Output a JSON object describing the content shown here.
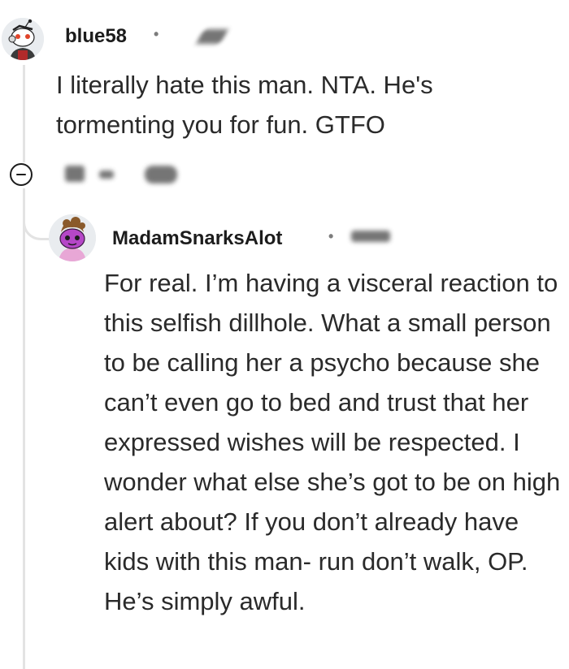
{
  "comments": [
    {
      "username": "blue58",
      "separator": "•",
      "text": "I literally hate this man. NTA. He's tormenting you for fun. GTFO",
      "avatar_icon": "snoo-avatar-icon"
    },
    {
      "username": "MadamSnarksAlot",
      "separator": "•",
      "text": "For real. I’m having a visceral reaction to this selfish dillhole. What a small person to be calling her a psycho because she can’t even go to bed and trust that her expressed wishes will be respected. I wonder what else she’s got to be on high alert about? If you don’t already have kids with this man- run don’t walk, OP. He’s simply awful.",
      "avatar_icon": "snoo-avatar-icon"
    }
  ],
  "controls": {
    "collapse_icon": "collapse-icon"
  },
  "colors": {
    "text": "#2a2a2a",
    "username": "#1c1c1c",
    "meta": "#7c7c7c",
    "thread_line": "#e3e3e3",
    "avatar2_accent": "#b547c7"
  }
}
